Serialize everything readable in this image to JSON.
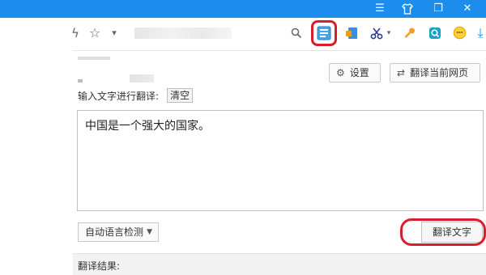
{
  "titlebar": {
    "color": "#1d8ded",
    "buttons": [
      {
        "name": "menu-icon",
        "glyph": "☰"
      },
      {
        "name": "skin-icon",
        "glyph": "👕"
      },
      {
        "name": "restore-icon",
        "glyph": "❐"
      },
      {
        "name": "close-icon",
        "glyph": "✕"
      }
    ]
  },
  "toolbar": {
    "icons": [
      {
        "name": "lightning-icon",
        "glyph": "ϟ"
      },
      {
        "name": "star-icon",
        "glyph": "☆"
      },
      {
        "name": "chevron-down-icon",
        "glyph": "▾"
      },
      {
        "name": "search-icon",
        "glyph": "⚲"
      },
      {
        "name": "translate-icon",
        "glyph": "▤"
      },
      {
        "name": "screen-icon",
        "glyph": "◩"
      },
      {
        "name": "scissors-icon",
        "glyph": "✂"
      },
      {
        "name": "key-icon",
        "glyph": "⚷"
      },
      {
        "name": "magnifier-icon",
        "glyph": "◙"
      },
      {
        "name": "smiley-icon",
        "glyph": "☺"
      },
      {
        "name": "download-icon",
        "glyph": "⤓"
      }
    ],
    "highlight_color": "#d81e2b"
  },
  "panel": {
    "settings_label": "设置",
    "translate_page_label": "翻译当前网页",
    "input_label": "输入文字进行翻译:",
    "clear_label": "清空",
    "input_text": "中国是一个强大的国家。",
    "language_label": "自动语言检测",
    "translate_button_label": "翻译文字",
    "result_label": "翻译结果:"
  }
}
